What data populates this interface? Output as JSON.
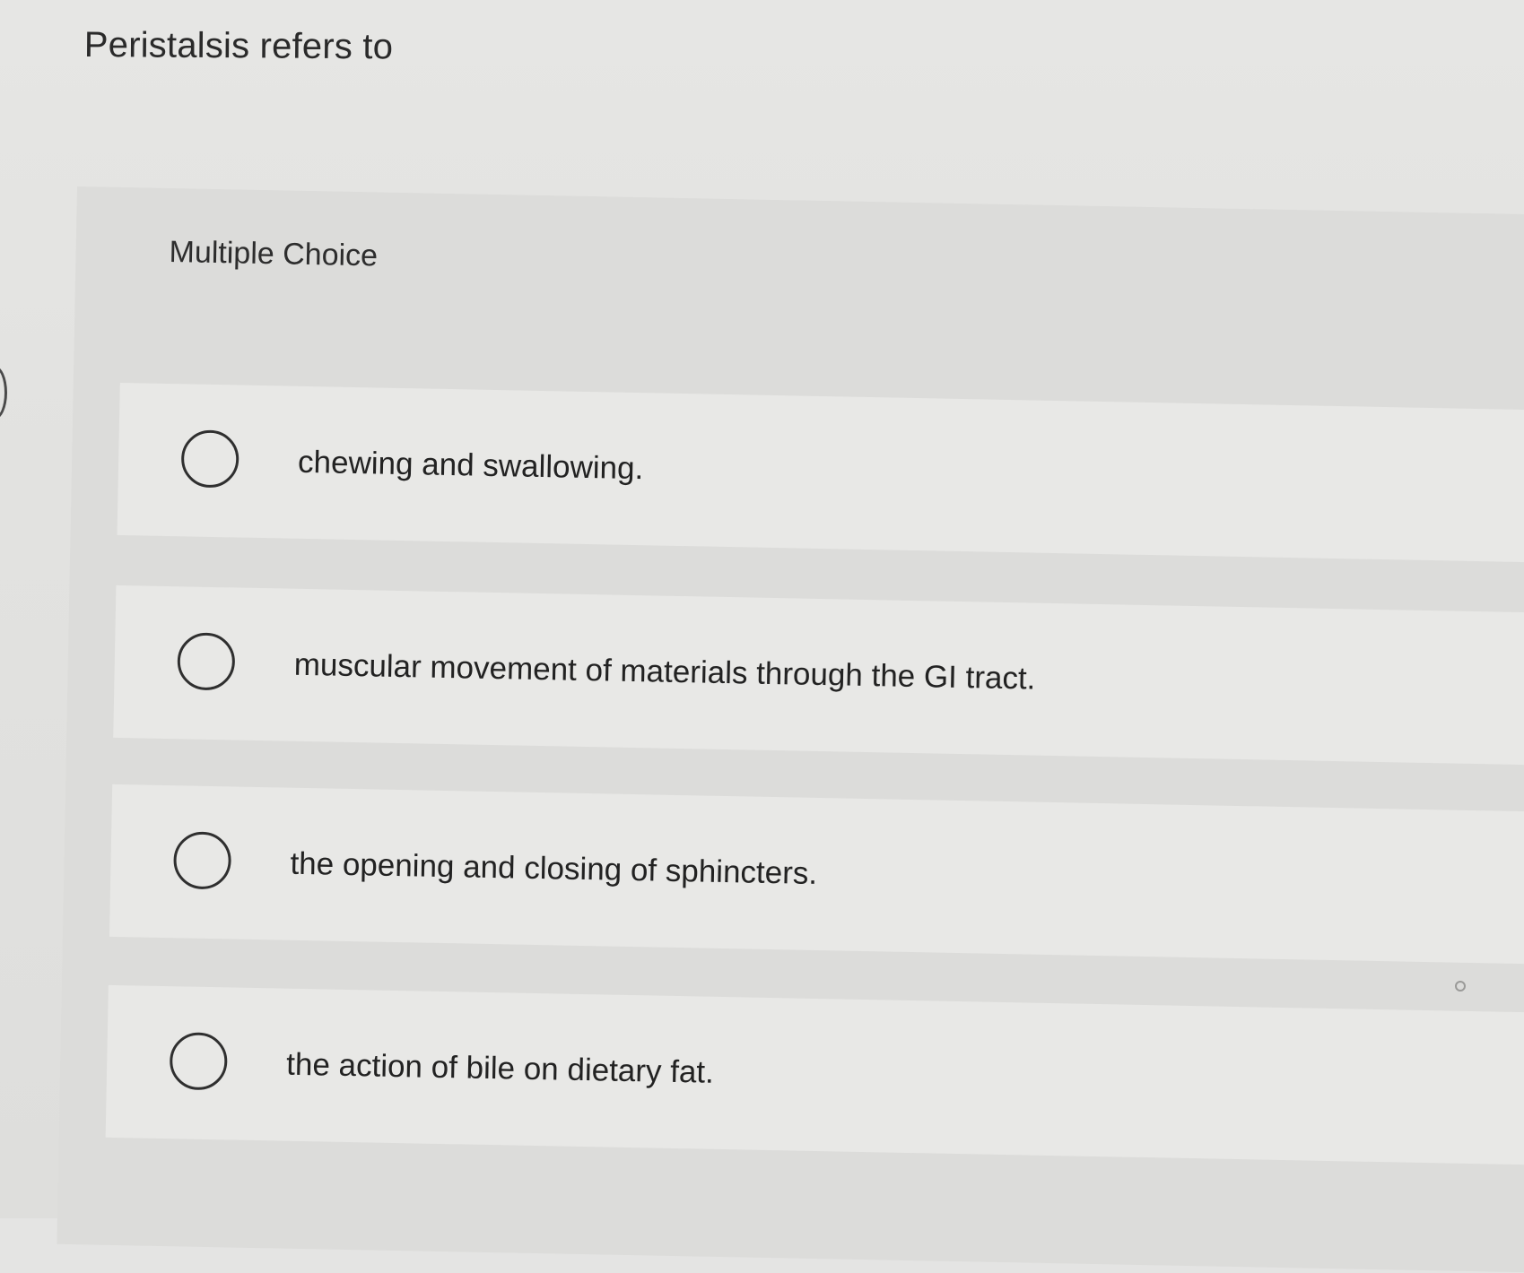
{
  "question": {
    "text": "Peristalsis refers to"
  },
  "multiple_choice": {
    "label": "Multiple Choice",
    "options": [
      {
        "label": "chewing and swallowing.",
        "selected": false
      },
      {
        "label": "muscular movement of materials through the GI tract.",
        "selected": false
      },
      {
        "label": "the opening and closing of sphincters.",
        "selected": false
      },
      {
        "label": "the action of bile on dietary fat.",
        "selected": false
      }
    ]
  },
  "colors": {
    "background": "#e4e4e3",
    "panel": "#dcdcda",
    "option_row": "#e8e8e6",
    "text": "#2b2b2b",
    "radio_border": "#2f2f2f"
  }
}
